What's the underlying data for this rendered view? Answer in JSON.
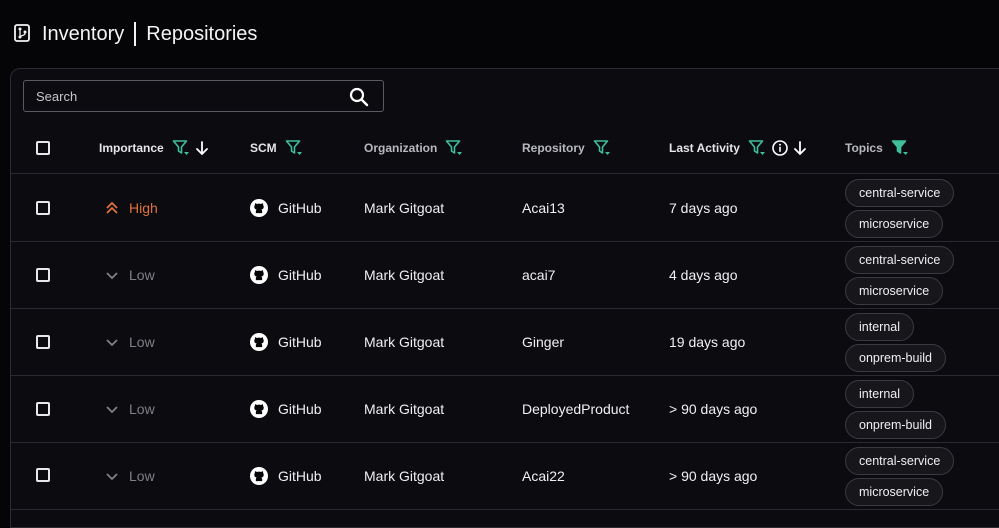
{
  "header": {
    "section": "Inventory",
    "page": "Repositories"
  },
  "search": {
    "placeholder": "Search"
  },
  "columns": {
    "importance": "Importance",
    "scm": "SCM",
    "organization": "Organization",
    "repository": "Repository",
    "last_activity": "Last Activity",
    "topics": "Topics"
  },
  "colors": {
    "accent_filter": "#3fbf9a",
    "high": "#e0703a",
    "low": "#7f7f87"
  },
  "rows": [
    {
      "importance": "High",
      "scm": "GitHub",
      "organization": "Mark Gitgoat",
      "repository": "Acai13",
      "last_activity": "7 days ago",
      "topics": [
        "central-service",
        "microservice"
      ]
    },
    {
      "importance": "Low",
      "scm": "GitHub",
      "organization": "Mark Gitgoat",
      "repository": "acai7",
      "last_activity": "4 days ago",
      "topics": [
        "central-service",
        "microservice"
      ]
    },
    {
      "importance": "Low",
      "scm": "GitHub",
      "organization": "Mark Gitgoat",
      "repository": "Ginger",
      "last_activity": "19 days ago",
      "topics": [
        "internal",
        "onprem-build"
      ]
    },
    {
      "importance": "Low",
      "scm": "GitHub",
      "organization": "Mark Gitgoat",
      "repository": "DeployedProduct",
      "last_activity": "> 90 days ago",
      "topics": [
        "internal",
        "onprem-build"
      ]
    },
    {
      "importance": "Low",
      "scm": "GitHub",
      "organization": "Mark Gitgoat",
      "repository": "Acai22",
      "last_activity": "> 90 days ago",
      "topics": [
        "central-service",
        "microservice"
      ]
    }
  ]
}
